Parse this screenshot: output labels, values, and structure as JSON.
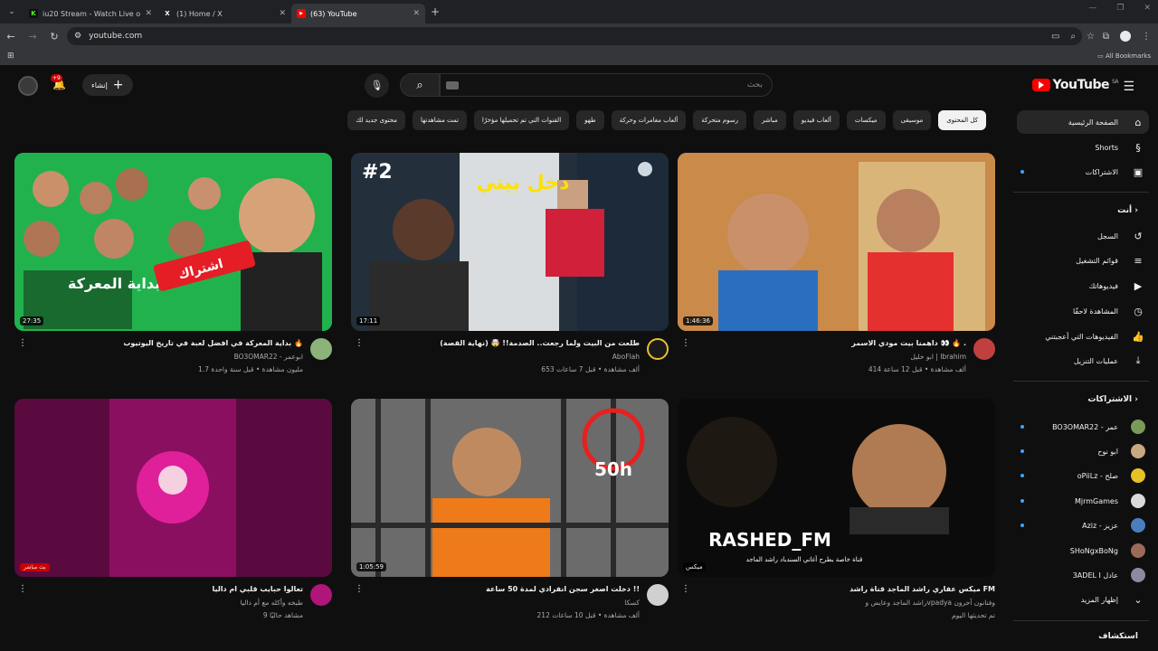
{
  "browser": {
    "tabs": [
      {
        "title": "iu20 Stream - Watch Live on Ki",
        "icon": "K",
        "color": "#53fc18"
      },
      {
        "title": "(1) Home / X",
        "icon": "X",
        "color": "#ffffff"
      },
      {
        "title": "(63) YouTube",
        "icon": "▶",
        "color": "#ff0000"
      }
    ],
    "url": "youtube.com",
    "all_bookmarks": "All Bookmarks"
  },
  "header": {
    "logo": "YouTube",
    "region": "SA",
    "search_placeholder": "بحث",
    "create_label": "إنشاء",
    "notifications": "+9"
  },
  "chips": [
    "كل المحتوى",
    "موسيقى",
    "ميكسات",
    "ألعاب فيديو",
    "مباشر",
    "رسوم متحركة",
    "ألعاب مغامرات وحركة",
    "طهو",
    "القنوات التي تم تحميلها مؤخرًا",
    "تمت مشاهدتها",
    "محتوى جديد لك"
  ],
  "sidebar": {
    "main": [
      {
        "label": "الصفحة الرئيسية",
        "icon": "home-icon"
      },
      {
        "label": "Shorts",
        "icon": "shorts-icon"
      },
      {
        "label": "الاشتراكات",
        "icon": "subscriptions-icon"
      }
    ],
    "you_header": "أنت",
    "you": [
      {
        "label": "السجل",
        "icon": "history-icon"
      },
      {
        "label": "قوائم التشغيل",
        "icon": "playlist-icon"
      },
      {
        "label": "فيديوهاتك",
        "icon": "your-videos-icon"
      },
      {
        "label": "المشاهدة لاحقًا",
        "icon": "watch-later-icon"
      },
      {
        "label": "الفيديوهات التي أعجبتني",
        "icon": "like-icon"
      },
      {
        "label": "عمليات التنزيل",
        "icon": "download-icon"
      }
    ],
    "subs_header": "الاشتراكات",
    "subs": [
      {
        "label": "BO3OMAR22 - عمر",
        "color": "#7a9a5a"
      },
      {
        "label": "ابو نوح",
        "color": "#c8a882"
      },
      {
        "label": "oPiiLz - صلح",
        "color": "#e6c229"
      },
      {
        "label": "MjrmGames",
        "color": "#d9d9d9"
      },
      {
        "label": "Aziz - عزيز",
        "color": "#4a7fbf"
      },
      {
        "label": "SHoNgxBoNg",
        "color": "#9a6a5a"
      },
      {
        "label": "3ADEL I عادل",
        "color": "#8a8aa0"
      }
    ],
    "show_more": "إظهار المزيد",
    "explore": "استكشاف"
  },
  "videos": [
    {
      "title": "بداية المعركة في افضل لعبة في تاريخ اليوتيوب 🔥",
      "channel": "BO3OMAR22 - ابوعمر",
      "stats": "1.7 مليون مشاهدة • قبل سنة واحدة",
      "duration": "27:35",
      "avatar_color": "#8bb37a",
      "thumb_text": "بداية المعركة",
      "thumb_badge": "اشتراك"
    },
    {
      "title": "طلعت من البيت ولما رجعت.. الصدمة!! 🤯 (نهاية القصة)",
      "channel": "AboFlah",
      "stats": "653 ألف مشاهدة • قبل 7 ساعات",
      "duration": "17:11",
      "avatar_color": "#e6c229",
      "thumb_text": "دخل بيتي",
      "thumb_badge": "#2"
    },
    {
      "title": "داهمنا بيت مودي الاسمر 👀 🔥 .",
      "channel": "ابو خليل | Ibrahim",
      "stats": "414 ألف مشاهدة • قبل 12 ساعة",
      "duration": "1:46:36",
      "avatar_color": "#c04040",
      "thumb_text": "",
      "thumb_badge": ""
    },
    {
      "title": "تعالوا حبايب قلبي ام داليا",
      "channel": "طبخه وأكله مع أم داليا",
      "stats": "9 مشاهد حاليًا",
      "duration": "بث مباشر",
      "avatar_color": "#b0157a",
      "thumb_text": "",
      "thumb_badge": ""
    },
    {
      "title": "دخلت اصغر سجن انفرادي لمدة 50 ساعة !!",
      "channel": "كسكا",
      "stats": "212 ألف مشاهدة • قبل 10 ساعات",
      "duration": "1:05:59",
      "avatar_color": "#d0d0d0",
      "thumb_text": "50h",
      "thumb_badge": ""
    },
    {
      "title": "ميكس عفاري راشد الماجد قناة راشد FM",
      "channel": "راشد الماجد وعايض وvpadya وفنانون آخرون",
      "stats": "تم تحديثها اليوم",
      "duration": "ميكس",
      "avatar_color": "",
      "thumb_text": "RASHED_FM",
      "thumb_badge": "قناة خاصة بطرح أغاني السندباد راشد الماجد"
    }
  ]
}
